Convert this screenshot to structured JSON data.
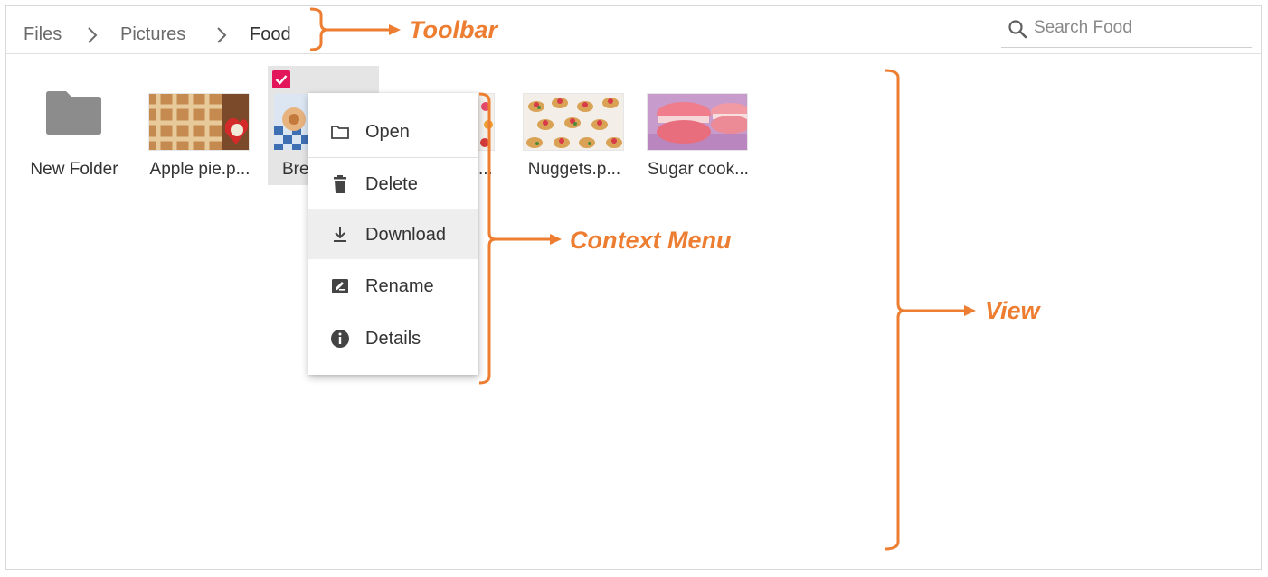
{
  "breadcrumb": {
    "items": [
      "Files",
      "Pictures",
      "Food"
    ]
  },
  "search": {
    "placeholder": "Search Food"
  },
  "view": {
    "items": [
      {
        "label": "New Folder",
        "type": "folder"
      },
      {
        "label": "Apple pie.p...",
        "type": "image"
      },
      {
        "label": "Bre",
        "type": "image",
        "selected": true
      },
      {
        "label": "...",
        "type": "image"
      },
      {
        "label": "Nuggets.p...",
        "type": "image"
      },
      {
        "label": "Sugar cook...",
        "type": "image"
      }
    ]
  },
  "context_menu": {
    "items": [
      {
        "label": "Open",
        "icon": "folder-outline-icon"
      },
      {
        "label": "Delete",
        "icon": "trash-icon"
      },
      {
        "label": "Download",
        "icon": "download-icon",
        "hovered": true
      },
      {
        "label": "Rename",
        "icon": "rename-icon"
      },
      {
        "label": "Details",
        "icon": "info-icon"
      }
    ]
  },
  "annotations": {
    "toolbar": "Toolbar",
    "context_menu": "Context Menu",
    "view": "View"
  },
  "colors": {
    "annotation": "#ed7d31",
    "selection_check": "#e3165b",
    "folder": "#8c8c8c"
  }
}
